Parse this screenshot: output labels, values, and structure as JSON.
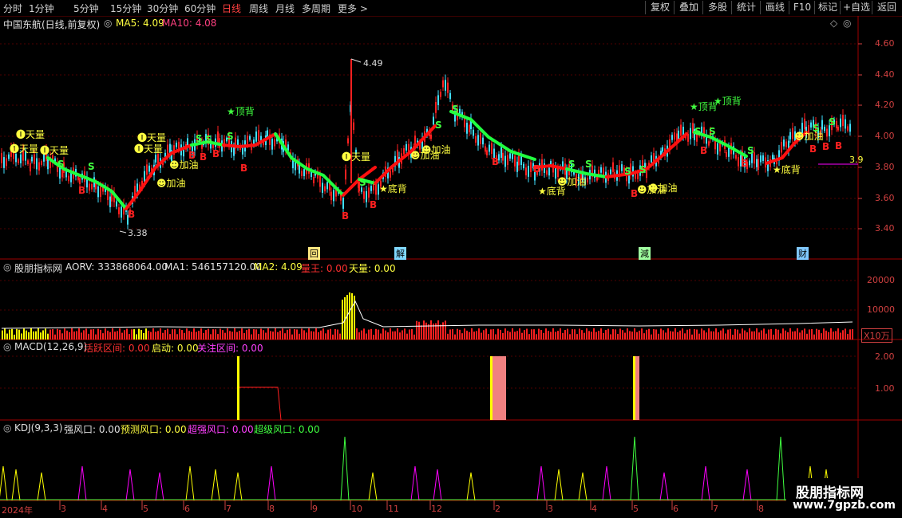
{
  "tabs": {
    "fs": "分时",
    "m1": "1分钟",
    "m5": "5分钟",
    "m15": "15分钟",
    "m30": "30分钟",
    "m60": "60分钟",
    "day": "日线",
    "week": "周线",
    "month": "月线",
    "multi": "多周期",
    "more": "更多 >"
  },
  "toolbar": {
    "fuquan": "复权",
    "overlay": "叠加",
    "multi": "多股",
    "stats": "统计",
    "draw": "画线",
    "f10": "F10",
    "mark": "标记",
    "add": "+自选",
    "back": "返回"
  },
  "main": {
    "stock": "中国东航(日线,前复权)",
    "ma5_label": "MA5: 4.09",
    "ma10_label": "MA10: 4.08",
    "y_ticks": [
      "4.60",
      "4.40",
      "4.20",
      "4.00",
      "3.80",
      "3.60",
      "3.40"
    ],
    "high_label": "4.49",
    "low_label": "3.38",
    "last_value": "3.9",
    "annotations": {
      "tianliang": "天量",
      "jiayou": "加油",
      "dingbei": "顶背",
      "dibei": "底背",
      "b": "B",
      "s": "S"
    },
    "events": [
      "回",
      "解",
      "減",
      "财"
    ]
  },
  "vol": {
    "title": "股朋指标网",
    "aorv": "AORV: 333868064.00",
    "ma1": "MA1: 546157120.00",
    "ma2": "MA2: 4.09",
    "liangwang": "量王: 0.00",
    "tianliang": "天量: 0.00",
    "ticks": [
      "20000",
      "10000"
    ],
    "unit": "X10万"
  },
  "macd": {
    "title": "MACD(12,26,9)",
    "huoyue": "活跃区间: 0.00",
    "qidong": "启动: 0.00",
    "guanzhu": "关注区间: 0.00",
    "ticks": [
      "2.00",
      "1.00"
    ]
  },
  "kdj": {
    "title": "KDJ(9,3,3)",
    "qiang": "强风口: 0.00",
    "yuce": "预测风口: 0.00",
    "chaoqiang": "超强风口: 0.00",
    "chaoji": "超级风口: 0.00"
  },
  "xaxis": {
    "labels": [
      "2024年",
      "3",
      "4",
      "5",
      "6",
      "7",
      "8",
      "9",
      "10",
      "11",
      "12",
      "2",
      "3",
      "4",
      "5",
      "6",
      "7",
      "8"
    ]
  },
  "watermark": {
    "line1": "股朋指标网",
    "line2": "www.7gpzb.com"
  },
  "colors": {
    "up": "#ff2020",
    "down": "#40e0ff",
    "ma_up": "#ff1010",
    "ma_down": "#20ff40",
    "yellow": "#ffff00",
    "axis": "#d04040",
    "pink": "#ff00ff"
  }
}
